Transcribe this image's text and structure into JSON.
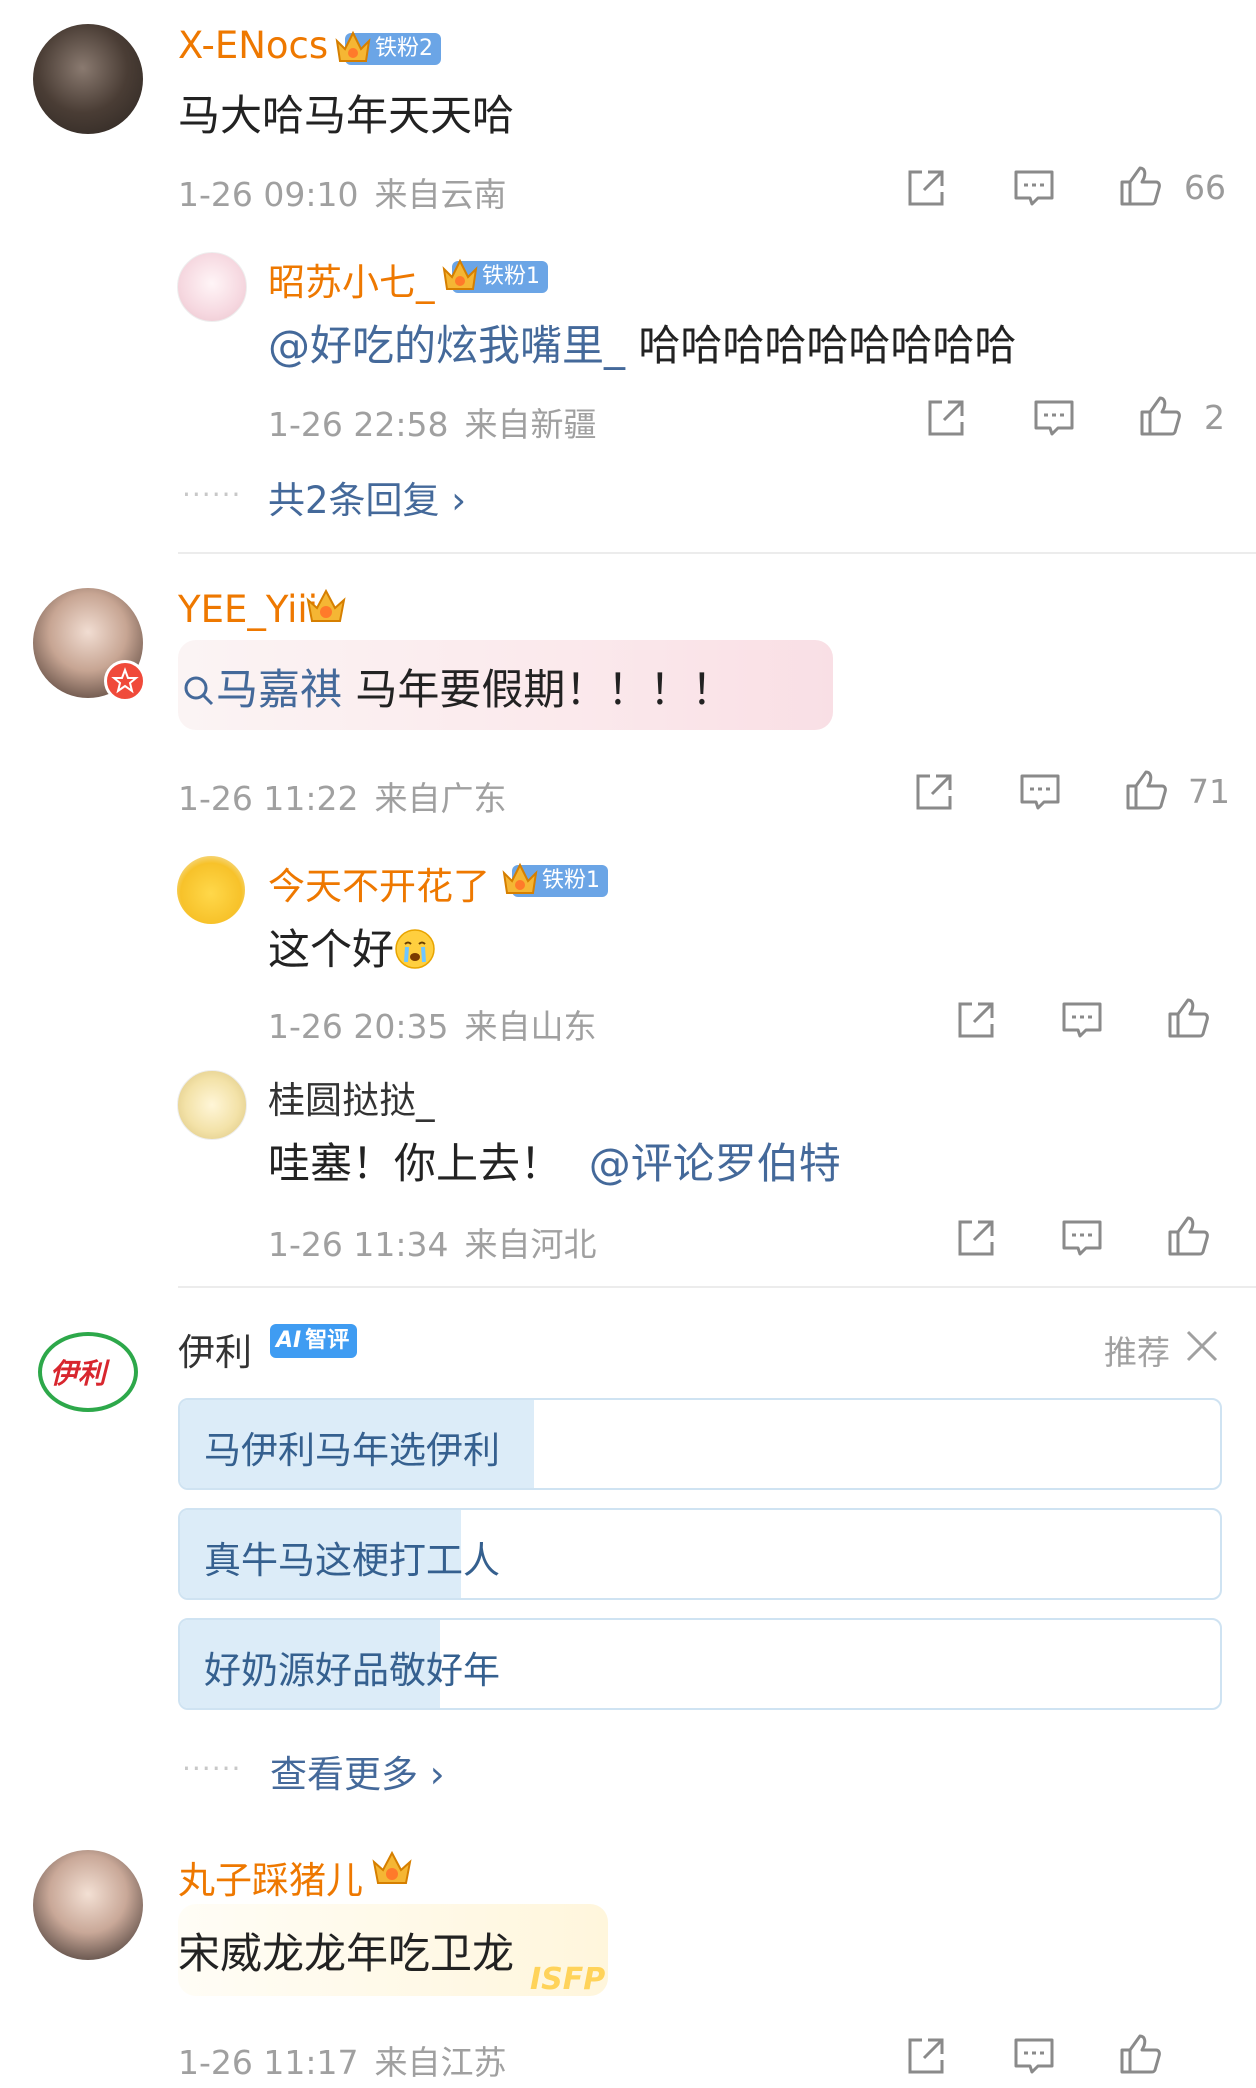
{
  "comments": [
    {
      "user": "X-ENocs",
      "fan_badge": "铁粉2",
      "text": "马大哈马年天天哈",
      "date": "1-26 09:10",
      "location": "来自云南",
      "likes": "66",
      "replies": [
        {
          "user": "昭苏小七_",
          "fan_badge": "铁粉1",
          "mention": "@好吃的炫我嘴里_",
          "text": "哈哈哈哈哈哈哈哈哈",
          "date": "1-26 22:58",
          "location": "来自新疆",
          "likes": "2"
        }
      ],
      "more_replies": "共2条回复"
    },
    {
      "user": "YEE_Yiii",
      "search_topic": "马嘉祺",
      "text": "马年要假期！！！！",
      "date": "1-26 11:22",
      "location": "来自广东",
      "likes": "71",
      "replies": [
        {
          "user": "今天不开花了",
          "fan_badge": "铁粉1",
          "text": "这个好",
          "date": "1-26 20:35",
          "location": "来自山东"
        },
        {
          "user": "桂圆挞挞_",
          "text": "哇塞！你上去！",
          "mention": "@评论罗伯特",
          "date": "1-26 11:34",
          "location": "来自河北"
        }
      ]
    }
  ],
  "ad": {
    "brand": "伊利",
    "logo_text": "伊利",
    "tag": "智评",
    "recommend": "推荐",
    "options": [
      "马伊利马年选伊利",
      "真牛马这梗打工人",
      "好奶源好品敬好年"
    ],
    "option_fill": [
      0.34,
      0.27,
      0.25
    ],
    "more": "查看更多"
  },
  "last_comment": {
    "user": "丸子踩猪儿",
    "text": "宋威龙龙年吃卫龙",
    "sticker": "ISFP",
    "date": "1-26 11:17",
    "location": "来自江苏"
  },
  "colors": {
    "username": "#ee7800",
    "link": "#44699a",
    "meta": "#a0a0a0",
    "fan_badge": "#6ba5e6",
    "ai_fill": "#dcecf8"
  }
}
